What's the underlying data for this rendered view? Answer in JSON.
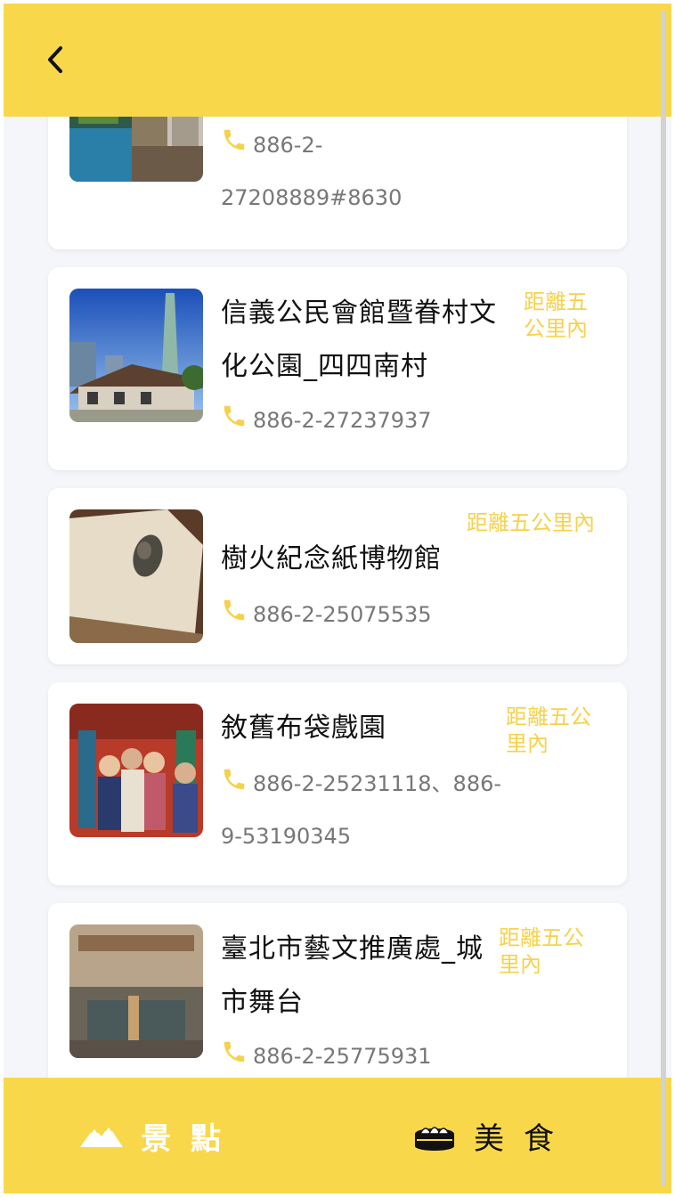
{
  "header": {
    "back_icon": "chevron-left-icon"
  },
  "places": [
    {
      "name": "",
      "distance": "",
      "phone_line1": "886-2-",
      "phone_line2": "27208889#8630"
    },
    {
      "name_line1": "信義公民會館暨眷村文",
      "name_line2": "化公園_四四南村",
      "distance_line1": "距離五",
      "distance_line2": "公里內",
      "phone_line1": "886-2-27237937"
    },
    {
      "name_line1": "樹火紀念紙博物館",
      "distance_line1": "距離五公里內",
      "phone_line1": "886-2-25075535"
    },
    {
      "name_line1": "敘舊布袋戲園",
      "distance_line1": "距離五公",
      "distance_line2": "里內",
      "phone_line1": "886-2-25231118、886-",
      "phone_line2": "9-53190345"
    },
    {
      "name_line1": "臺北市藝文推廣處_城",
      "name_line2": "市舞台",
      "distance_line1": "距離五公",
      "distance_line2": "里內",
      "phone_line1": "886-2-25775931"
    }
  ],
  "footer": {
    "sights_label": "景點",
    "food_label": "美食",
    "sights_icon": "mountain-icon",
    "food_icon": "dumpling-icon"
  },
  "colors": {
    "accent": "#f8d84a",
    "distance": "#f5d24b",
    "background": "#f5f6fa"
  }
}
